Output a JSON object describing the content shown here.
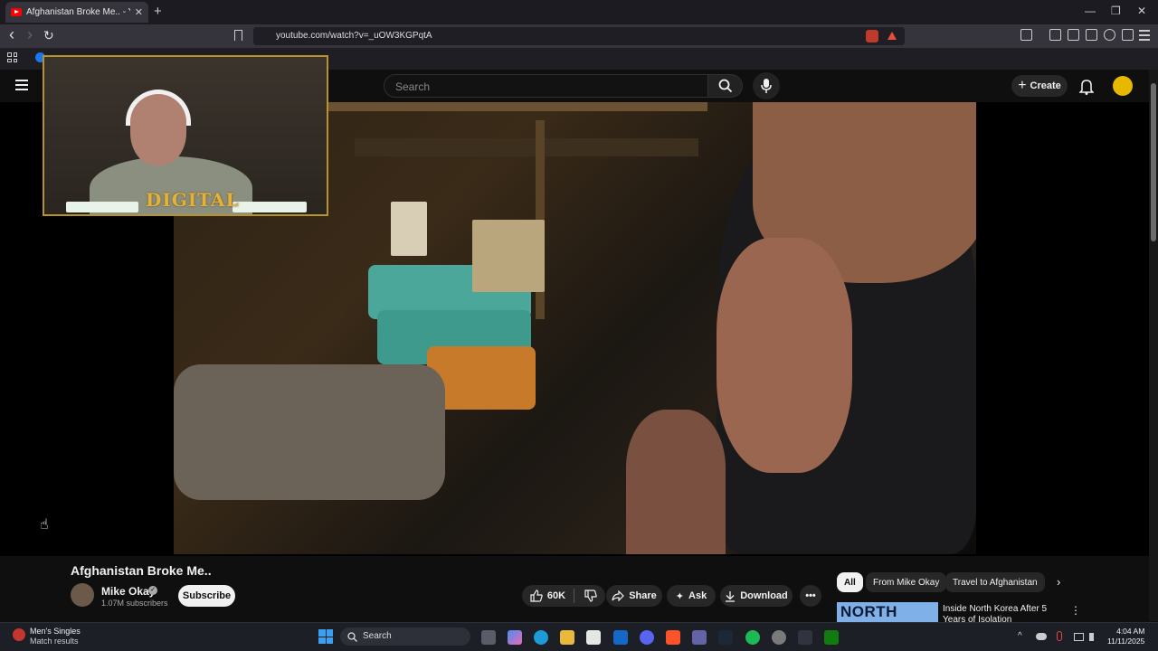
{
  "browser": {
    "tab_title": "Afghanistan Broke Me.. - You",
    "tab_close": "✕",
    "new_tab": "+",
    "url": "youtube.com/watch?v=_uOW3KGPqtA",
    "window_controls": [
      "—",
      "❐",
      "✕"
    ],
    "nav": {
      "back": "‹",
      "forward": "›",
      "reload": "↻"
    }
  },
  "header": {
    "search_placeholder": "Search",
    "create_label": "Create"
  },
  "webcam_overlay": {
    "logo_text": "DIGITAL"
  },
  "video": {
    "title": "Afghanistan Broke Me..",
    "channel": "Mike Okay",
    "subscribers": "1.07M subscribers",
    "subscribe_label": "Subscribe",
    "likes": "60K",
    "share_label": "Share",
    "ask_label": "Ask",
    "download_label": "Download",
    "more": "•••"
  },
  "sidebar": {
    "chips": [
      "All",
      "From Mike Okay",
      "Travel to Afghanistan"
    ],
    "next": "›",
    "recommended": {
      "thumb_text": "NORTH KOREA",
      "title": "Inside North Korea After 5 Years of Isolation",
      "more": "⋮"
    }
  },
  "taskbar": {
    "widget_title": "Men's Singles",
    "widget_subtitle": "Match results",
    "search_label": "Search",
    "time": "4:04 AM",
    "date": "11/11/2025",
    "caret": "^"
  },
  "colors": {
    "youtube_red": "#ff0000",
    "background": "#0f0f0f",
    "chip_active": "#f1f1f1",
    "webcam_border": "#b8922a"
  },
  "icons": [
    "youtube-icon",
    "search-icon",
    "mic-icon",
    "bell-icon",
    "like-icon",
    "dislike-icon",
    "share-icon",
    "sparkle-icon",
    "download-icon",
    "windows-start-icon"
  ]
}
